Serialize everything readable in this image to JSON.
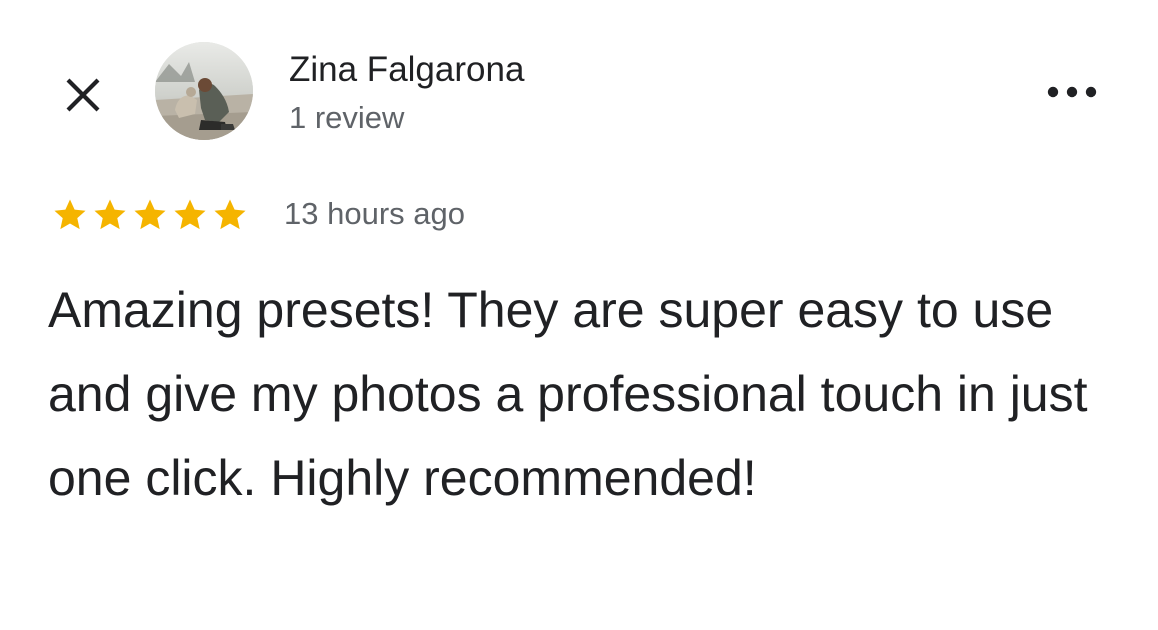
{
  "header": {
    "close_icon": "close-icon",
    "more_icon": "more-horizontal-icon"
  },
  "reviewer": {
    "name": "Zina Falgarona",
    "review_count": "1 review",
    "avatar_icon": "avatar-photo"
  },
  "review": {
    "rating": 5,
    "rating_max": 5,
    "star_color": "#F5B400",
    "timestamp": "13 hours ago",
    "text": "Amazing presets! They are super easy to use and give my photos a professional touch in just one click. Highly recommended!"
  }
}
